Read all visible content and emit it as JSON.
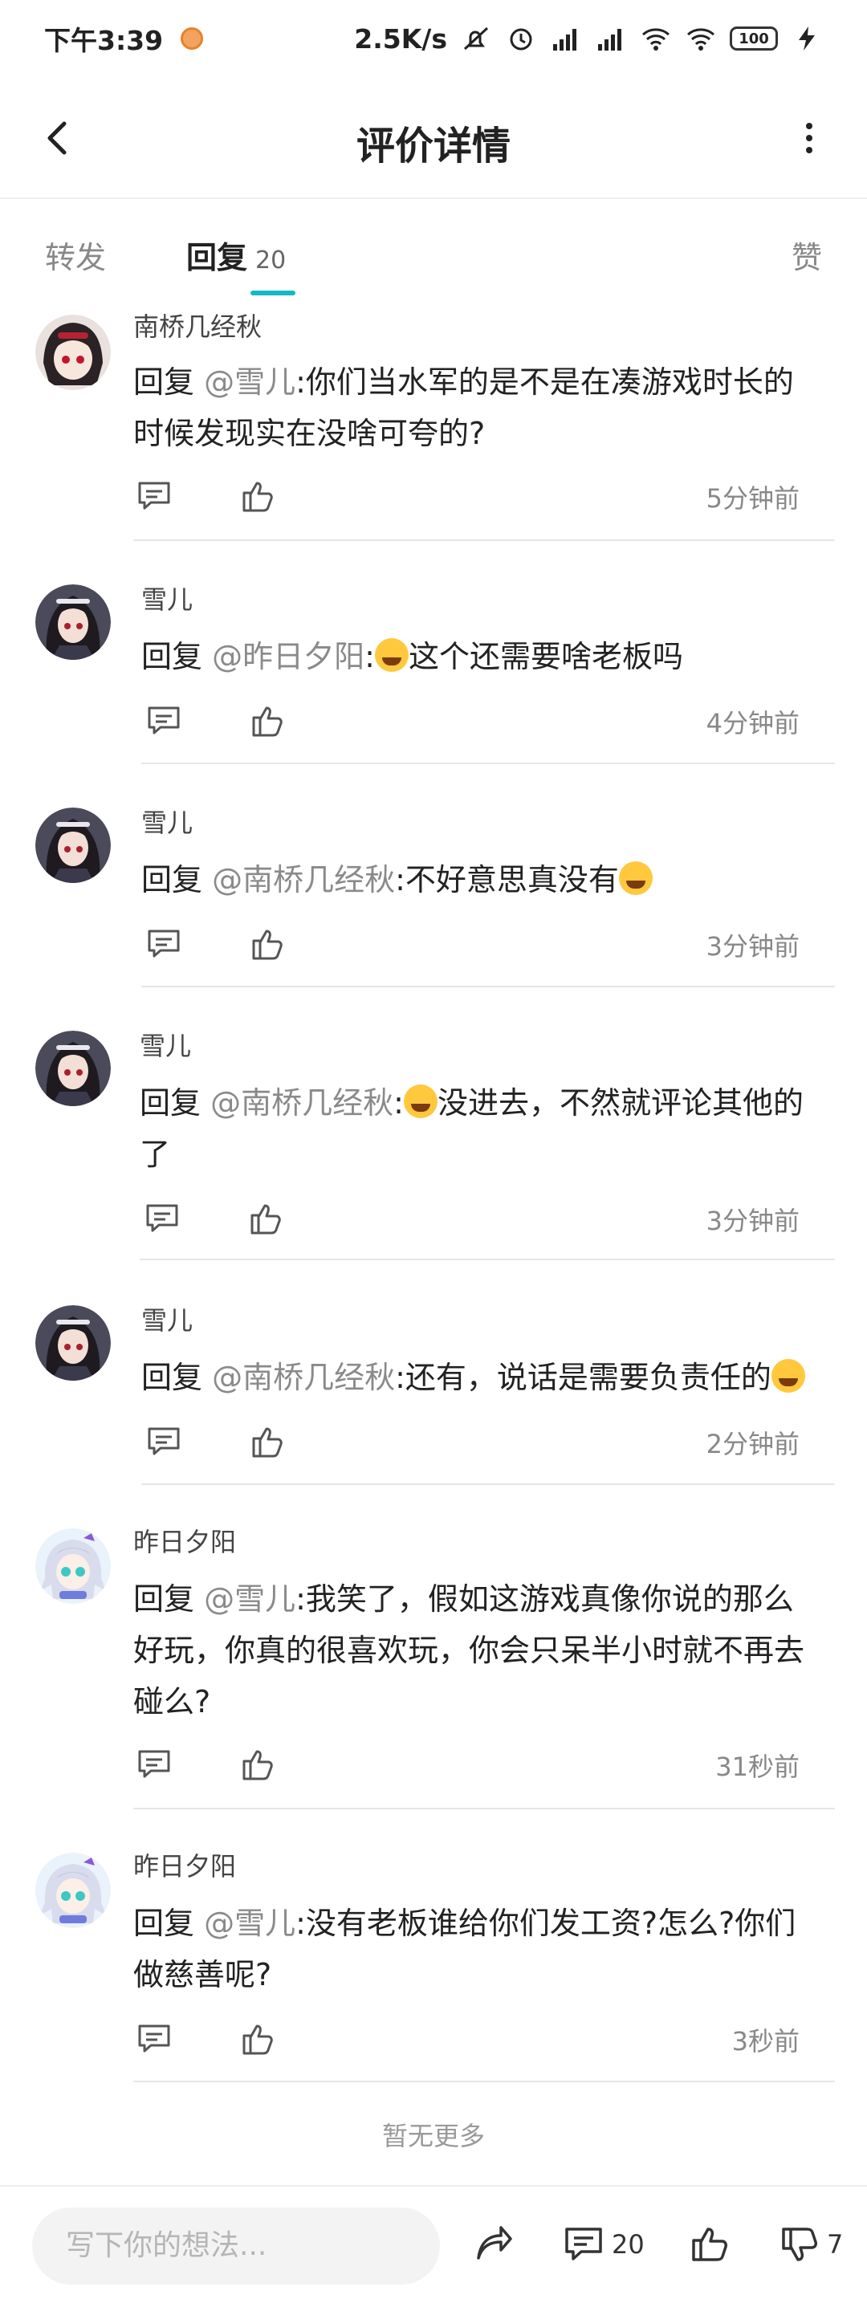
{
  "status_bar": {
    "time": "下午3:39",
    "speed": "2.5K/s",
    "battery": "100"
  },
  "header": {
    "title": "评价详情"
  },
  "tabs": {
    "forward": "转发",
    "reply": "回复",
    "reply_count": "20",
    "like": "赞"
  },
  "comments": [
    {
      "user": "南桥几经秋",
      "prefix": "回复",
      "mention": "@雪儿",
      "text_before": ":你们当水军的是不是在凑游戏时长的时候发现实在没啥可夸的?",
      "text_after": "",
      "time": "5分钟前"
    },
    {
      "user": "雪儿",
      "prefix": "回复",
      "mention": "@昨日夕阳",
      "text_before": ":",
      "text_after": "这个还需要啥老板吗",
      "time": "4分钟前"
    },
    {
      "user": "雪儿",
      "prefix": "回复",
      "mention": "@南桥几经秋",
      "text_before": ":不好意思真没有",
      "text_after": "",
      "time": "3分钟前"
    },
    {
      "user": "雪儿",
      "prefix": "回复",
      "mention": "@南桥几经秋",
      "text_before": ":",
      "text_after": "没进去，不然就评论其他的了",
      "time": "3分钟前"
    },
    {
      "user": "雪儿",
      "prefix": "回复",
      "mention": "@南桥几经秋",
      "text_before": ":还有，说话是需要负责任的",
      "text_after": "",
      "time": "2分钟前"
    },
    {
      "user": "昨日夕阳",
      "prefix": "回复",
      "mention": "@雪儿",
      "text_before": ":我笑了，假如这游戏真像你说的那么好玩，你真的很喜欢玩，你会只呆半小时就不再去碰么?",
      "text_after": "",
      "time": "31秒前"
    },
    {
      "user": "昨日夕阳",
      "prefix": "回复",
      "mention": "@雪儿",
      "text_before": ":没有老板谁给你们发工资?怎么?你们做慈善呢?",
      "text_after": "",
      "time": "3秒前"
    }
  ],
  "no_more": "暂无更多",
  "bottom_bar": {
    "input_placeholder": "写下你的想法...",
    "comment_count": "20",
    "dislike_count": "7"
  },
  "colors": {
    "accent": "#14b9c8",
    "mention": "#8a8a8a"
  }
}
